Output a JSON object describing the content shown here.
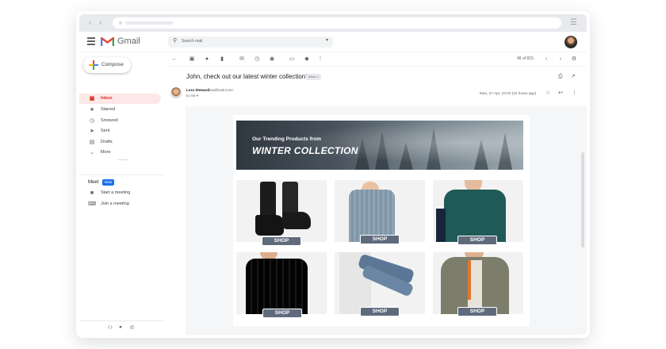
{
  "gmail": {
    "brand": "Gmail",
    "search_placeholder": "Search mail"
  },
  "sidebar": {
    "compose_label": "Compose",
    "items": [
      {
        "label": "Inbox",
        "icon": "inbox-icon",
        "active": true
      },
      {
        "label": "Starred",
        "icon": "star-icon"
      },
      {
        "label": "Snoozed",
        "icon": "clock-icon"
      },
      {
        "label": "Sent",
        "icon": "send-icon"
      },
      {
        "label": "Drafts",
        "icon": "draft-icon"
      },
      {
        "label": "More",
        "icon": "chevron-down-icon"
      }
    ],
    "meet": {
      "title": "Meet",
      "badge": "New",
      "items": [
        {
          "label": "Start a meeting",
          "icon": "video-icon"
        },
        {
          "label": "Join a meeting",
          "icon": "keyboard-icon"
        }
      ]
    }
  },
  "toolbar": {
    "count": "46 of 815"
  },
  "email": {
    "subject": "John, check out our latest winter collection!",
    "label": "Inbox ×",
    "sender_name": "Lora Steward",
    "sender_email": "<lora@mail.com>",
    "to": "to me ▾",
    "date": "Mon, 27 Apr, 23:33 (22 hours ago)"
  },
  "banner": {
    "line1": "Our Trending Products from",
    "line2": "WINTER COLLECTION"
  },
  "products": [
    {
      "name": "black-boots",
      "shop": "SHOP"
    },
    {
      "name": "knit-sweater",
      "shop": "SHOP"
    },
    {
      "name": "green-pullover",
      "shop": "SHOP"
    },
    {
      "name": "check-sweater",
      "shop": "SHOP"
    },
    {
      "name": "jeans",
      "shop": "SHOP"
    },
    {
      "name": "parka",
      "shop": "SHOP"
    }
  ],
  "colors": {
    "accent_red": "#d93025",
    "shop_button": "#5f6b7d",
    "meet_badge": "#1a73e8"
  }
}
